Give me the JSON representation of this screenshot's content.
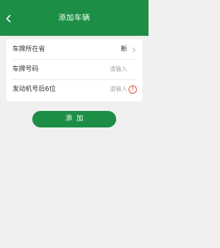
{
  "header": {
    "title": "添加车辆",
    "back_icon": "chevron-left-icon"
  },
  "form": {
    "province": {
      "label": "车牌所在省",
      "value": "新"
    },
    "plate_number": {
      "label": "车牌号码",
      "placeholder": "请输入"
    },
    "engine_number": {
      "label": "发动机号后6位",
      "placeholder": "请输入",
      "help_icon": "?"
    }
  },
  "actions": {
    "add_label": "添加"
  },
  "colors": {
    "brand": "#1c8e45",
    "background": "#f0f0f0",
    "help": "#d9463b"
  }
}
